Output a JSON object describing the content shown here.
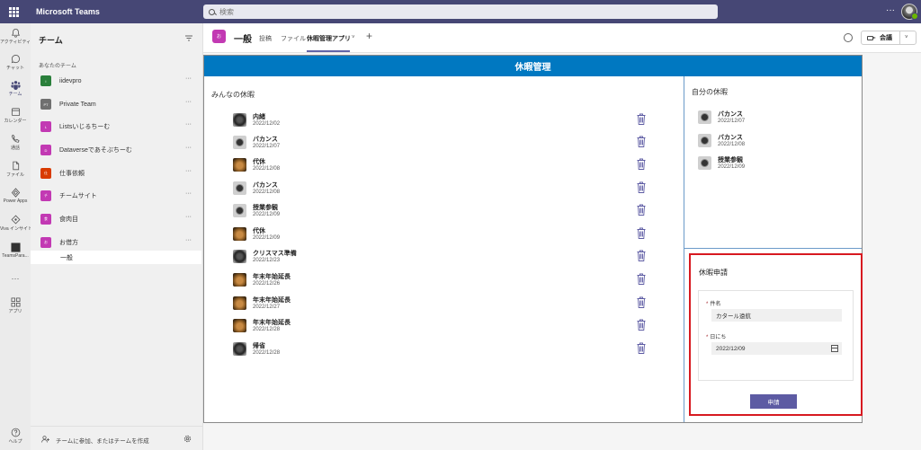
{
  "topbar": {
    "app_name": "Microsoft Teams",
    "search_placeholder": "検索",
    "more": "···"
  },
  "rail": [
    {
      "label": "アクティビティ",
      "icon": "bell-icon"
    },
    {
      "label": "チャット",
      "icon": "chat-icon"
    },
    {
      "label": "チーム",
      "icon": "teams-icon",
      "active": true
    },
    {
      "label": "カレンダー",
      "icon": "calendar-icon"
    },
    {
      "label": "通話",
      "icon": "phone-icon"
    },
    {
      "label": "ファイル",
      "icon": "file-icon"
    },
    {
      "label": "Power Apps",
      "icon": "powerapps-icon"
    },
    {
      "label": "Viva インサイト",
      "icon": "viva-insights-icon"
    },
    {
      "label": "TeamsPara...",
      "icon": "app-icon"
    },
    {
      "label": "···",
      "icon": "more-icon"
    },
    {
      "label": "アプリ",
      "icon": "apps-icon"
    },
    {
      "label": "ヘルプ",
      "icon": "help-icon"
    }
  ],
  "teams_panel": {
    "title": "チーム",
    "section": "あなたのチーム",
    "teams": [
      {
        "name": "iidevpro",
        "initial": "i",
        "color": "#2a7f3b"
      },
      {
        "name": "Private Team",
        "initial": "PT",
        "color": "#707070"
      },
      {
        "name": "Listsいじるちーむ",
        "initial": "L",
        "color": "#c239b3"
      },
      {
        "name": "Dataverseであそぶちーむ",
        "initial": "D",
        "color": "#c239b3"
      },
      {
        "name": "仕事依頼",
        "initial": "仕",
        "color": "#d83b01"
      },
      {
        "name": "チームサイト",
        "initial": "チ",
        "color": "#c239b3"
      },
      {
        "name": "食肉目",
        "initial": "食",
        "color": "#c239b3"
      },
      {
        "name": "お借方",
        "initial": "お",
        "color": "#c239b3"
      }
    ],
    "active_channel": "一般",
    "footer_text": "チームに参加、またはチームを作成"
  },
  "channel_header": {
    "tile": "お",
    "name": "一般",
    "tabs": [
      "投稿",
      "ファイル",
      "休暇管理アプリ"
    ],
    "active_tab_chevron": "˅",
    "add": "+",
    "meet_label": "会議",
    "meet_chevron": "˅"
  },
  "app": {
    "title": "休暇管理",
    "everyone_label": "みんなの休暇",
    "mine_label": "自分の休暇",
    "everyone": [
      {
        "title": "内緒",
        "date": "2022/12/02",
        "avatar": "pug"
      },
      {
        "title": "バカンス",
        "date": "2022/12/07",
        "avatar": "cam"
      },
      {
        "title": "代休",
        "date": "2022/12/08",
        "avatar": "dog"
      },
      {
        "title": "バカンス",
        "date": "2022/12/08",
        "avatar": "cam"
      },
      {
        "title": "授業参観",
        "date": "2022/12/09",
        "avatar": "cam"
      },
      {
        "title": "代休",
        "date": "2022/12/09",
        "avatar": "dog"
      },
      {
        "title": "クリスマス準備",
        "date": "2022/12/23",
        "avatar": "pug"
      },
      {
        "title": "年末年始延長",
        "date": "2022/12/26",
        "avatar": "dog"
      },
      {
        "title": "年末年始延長",
        "date": "2022/12/27",
        "avatar": "dog"
      },
      {
        "title": "年末年始延長",
        "date": "2022/12/28",
        "avatar": "dog"
      },
      {
        "title": "帰省",
        "date": "2022/12/28",
        "avatar": "pug"
      }
    ],
    "mine": [
      {
        "title": "バカンス",
        "date": "2022/12/07",
        "avatar": "cam"
      },
      {
        "title": "バカンス",
        "date": "2022/12/08",
        "avatar": "cam"
      },
      {
        "title": "授業参観",
        "date": "2022/12/09",
        "avatar": "cam"
      }
    ],
    "request": {
      "title": "休暇申請",
      "subject_label": "件名",
      "subject_value": "カタール遠航",
      "date_label": "日にち",
      "date_value": "2022/12/09",
      "required_mark": "*",
      "submit_label": "申請"
    }
  }
}
